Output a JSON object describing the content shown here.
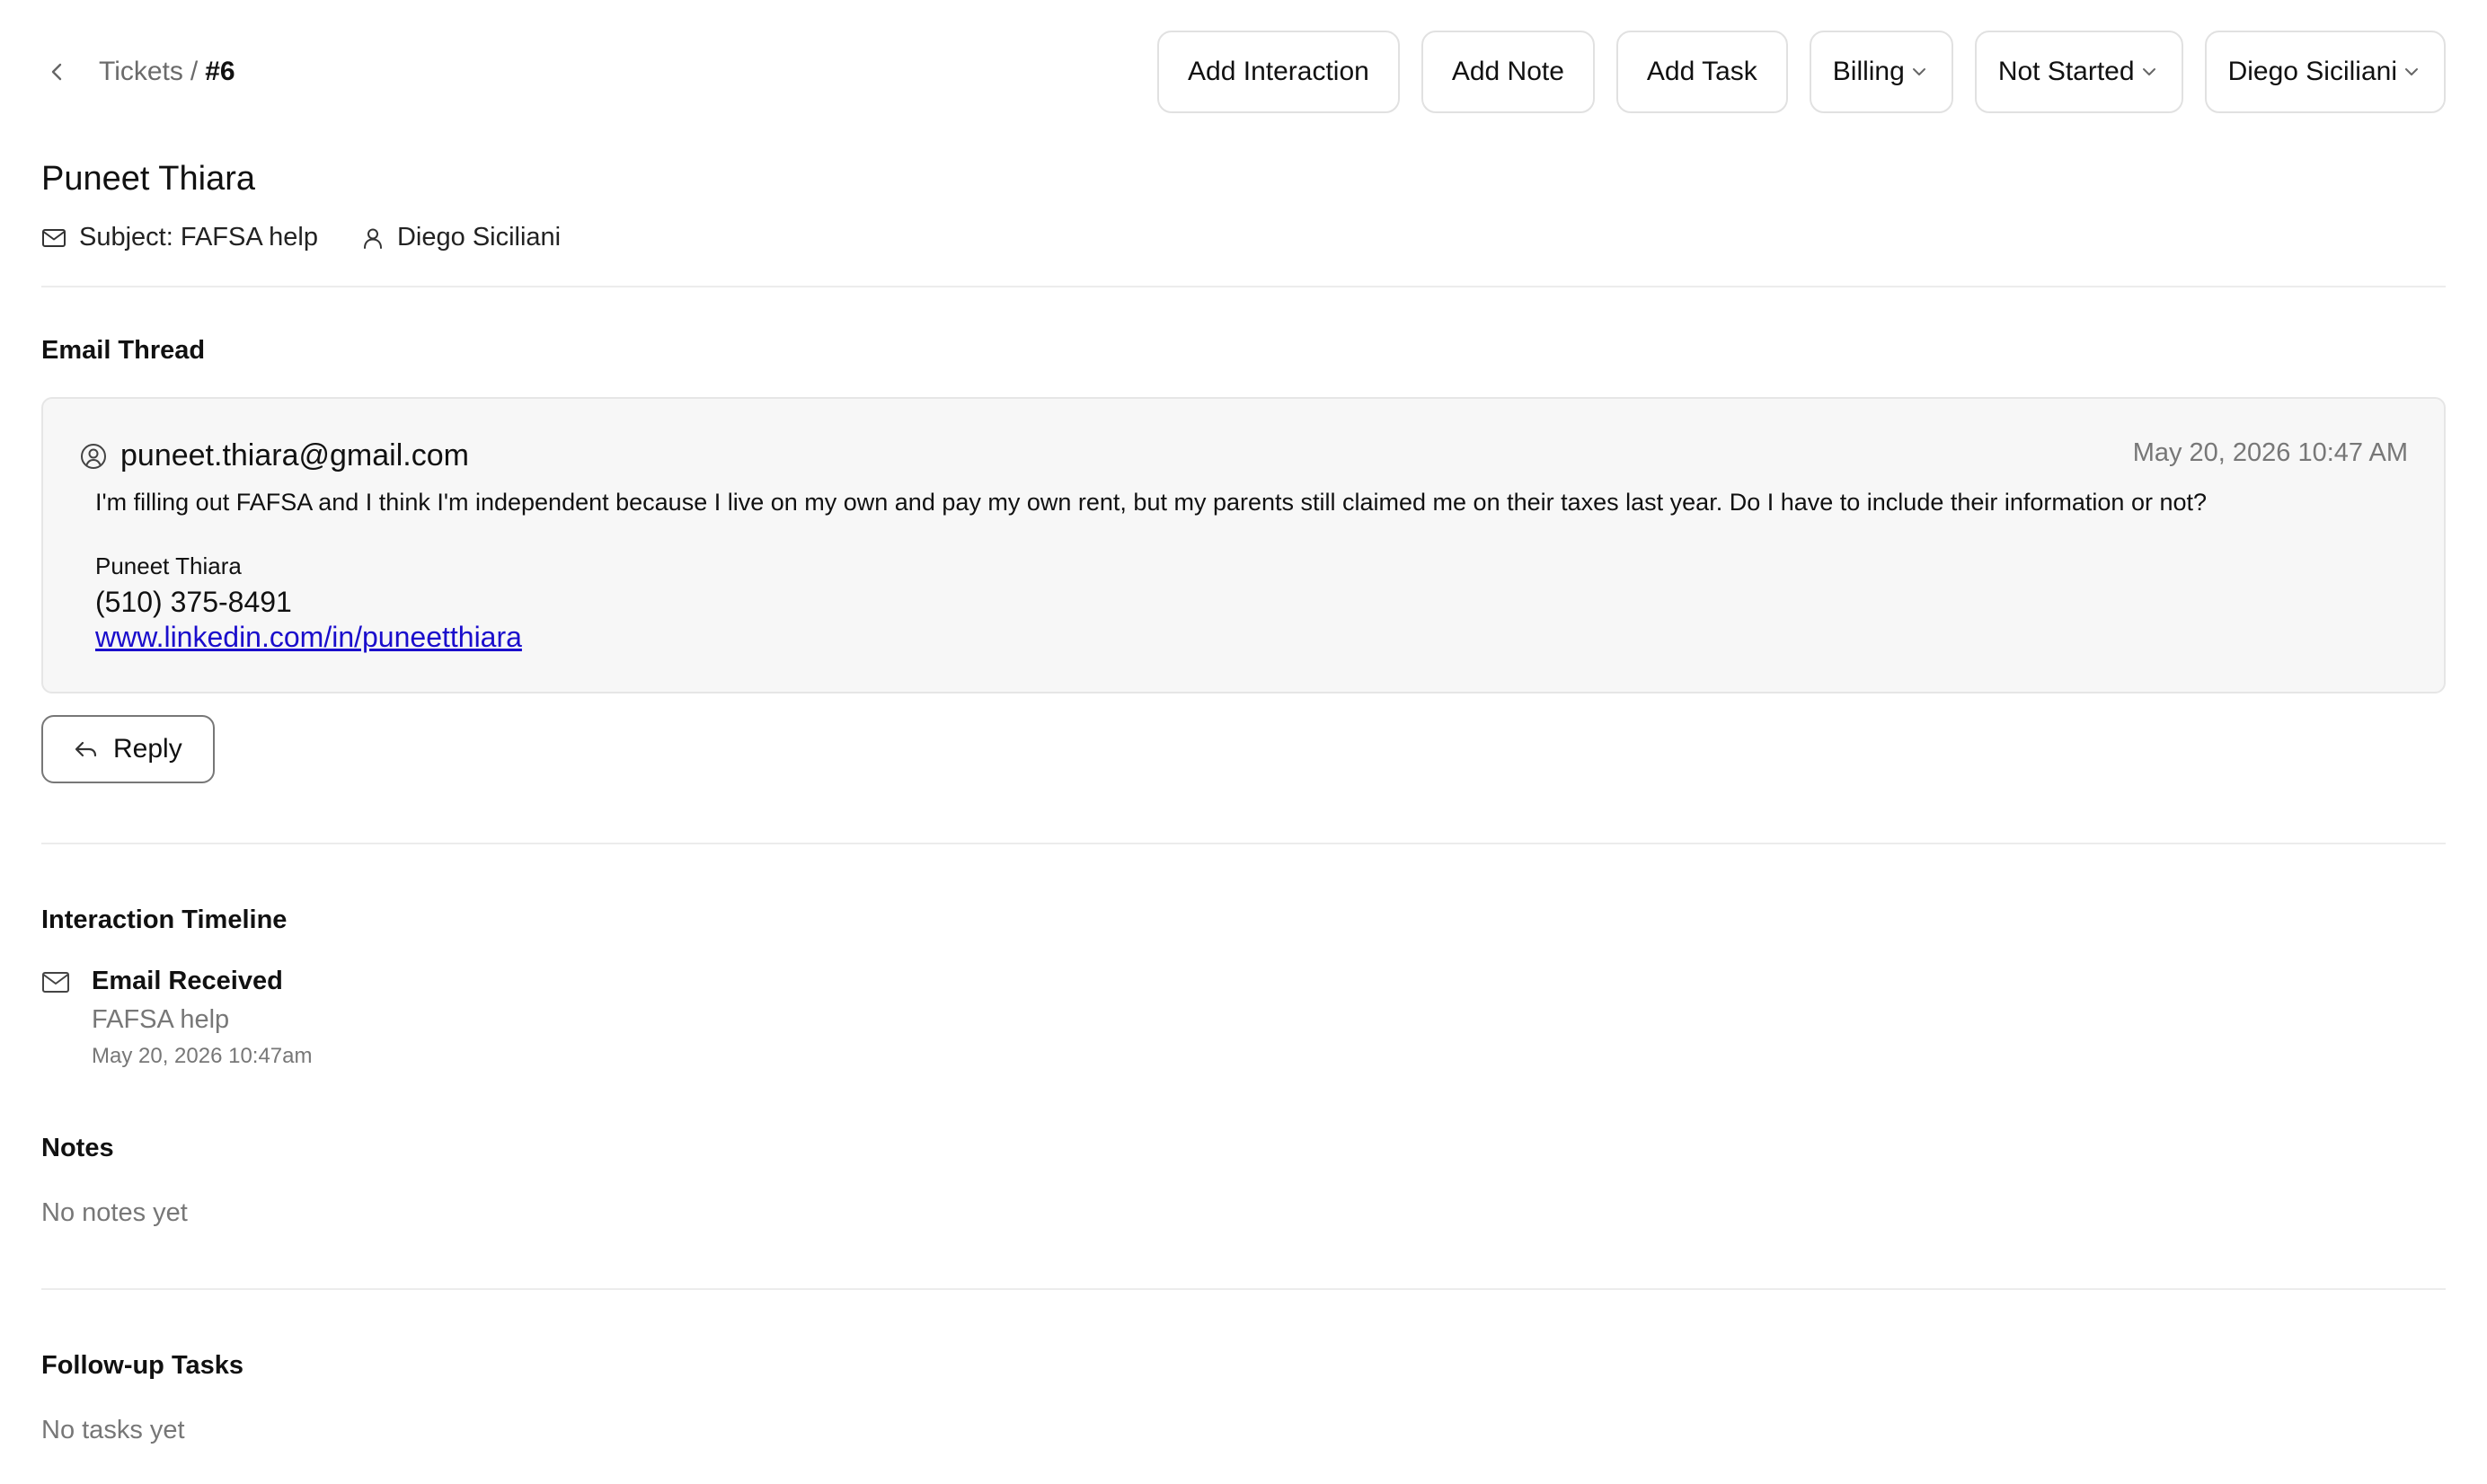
{
  "breadcrumb": {
    "parent": "Tickets",
    "separator": "/",
    "current": "#6"
  },
  "toolbar": {
    "add_interaction": "Add Interaction",
    "add_note": "Add Note",
    "add_task": "Add Task",
    "category": "Billing",
    "status": "Not Started",
    "assignee": "Diego Siciliani"
  },
  "ticket": {
    "contact_name": "Puneet Thiara",
    "subject": "Subject: FAFSA help",
    "assigned_to": "Diego Siciliani"
  },
  "email_thread": {
    "title": "Email Thread",
    "messages": [
      {
        "from": "puneet.thiara@gmail.com",
        "date": "May 20, 2026 10:47 AM",
        "body": "I'm filling out FAFSA and I think I'm independent because I live on my own and pay my own rent, but my parents still claimed me on their taxes last year. Do I have to include their information or not?",
        "signature_name": "Puneet Thiara",
        "signature_phone": "(510) 375-8491",
        "signature_link": "www.linkedin.com/in/puneetthiara"
      }
    ],
    "reply_label": "Reply"
  },
  "timeline": {
    "title": "Interaction Timeline",
    "items": [
      {
        "title": "Email Received",
        "subtitle": "FAFSA help",
        "date": "May 20, 2026 10:47am"
      }
    ]
  },
  "notes": {
    "title": "Notes",
    "empty": "No notes yet"
  },
  "tasks": {
    "title": "Follow-up Tasks",
    "empty": "No tasks yet"
  }
}
